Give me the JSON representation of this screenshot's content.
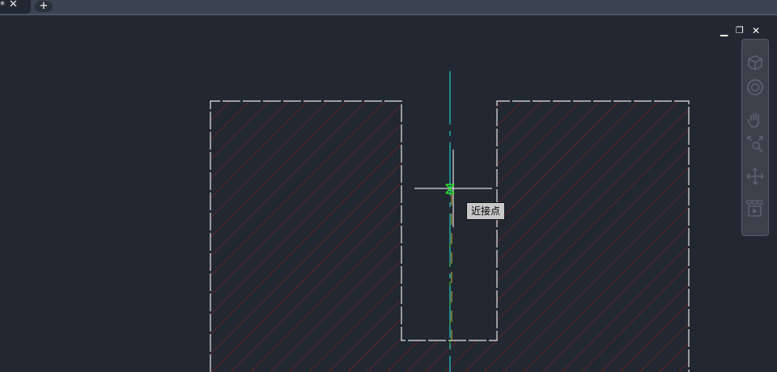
{
  "tabs": {
    "active": {
      "modified_marker": "*",
      "close_glyph": "✕"
    },
    "new_tab_glyph": "+"
  },
  "viewport_controls": {
    "minimize_glyph": "▁",
    "restore_glyph": "❐",
    "close_glyph": "✕"
  },
  "navigation_bar": {
    "tools": [
      "viewcube-icon",
      "steering-wheel-icon",
      "pan-hand-icon",
      "zoom-extents-icon",
      "orbit-icon",
      "showmotion-icon"
    ]
  },
  "snap_tooltip": {
    "text": "近接点"
  },
  "colors": {
    "background": "#222831",
    "outline": "#e6e6e6",
    "hatch": "#8a1c22",
    "centerline": "#22c7c7",
    "crosshair": "#ffffff",
    "snap_marker": "#2ee82e"
  }
}
